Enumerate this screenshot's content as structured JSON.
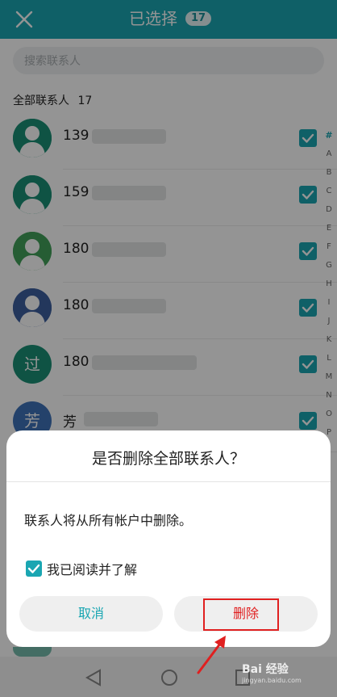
{
  "header": {
    "title": "已选择",
    "count": "17"
  },
  "search": {
    "placeholder": "搜索联系人"
  },
  "section": {
    "label": "全部联系人",
    "count": "17"
  },
  "contacts": [
    {
      "prefix": "139",
      "avatar": "person",
      "color": "#1a8f75",
      "blur": "short"
    },
    {
      "prefix": "159",
      "avatar": "person",
      "color": "#1a8f75",
      "blur": "short"
    },
    {
      "prefix": "180",
      "avatar": "person",
      "color": "#43a05a",
      "blur": "short"
    },
    {
      "prefix": "180",
      "avatar": "person",
      "color": "#3d5f9f",
      "blur": "short"
    },
    {
      "prefix": "180",
      "avatar": "过",
      "color": "#1a8f75",
      "blur": "long"
    },
    {
      "prefix": "芳",
      "avatar": "芳",
      "color": "#3f73b8",
      "blur": "short"
    }
  ],
  "index": [
    "#",
    "A",
    "B",
    "C",
    "D",
    "E",
    "F",
    "G",
    "H",
    "I",
    "J",
    "K",
    "L",
    "M",
    "N",
    "O",
    "P"
  ],
  "dialog": {
    "title": "是否删除全部联系人？",
    "message": "联系人将从所有帐户中删除。",
    "ack_label": "我已阅读并了解",
    "cancel_label": "取消",
    "delete_label": "删除"
  },
  "watermark": {
    "text": "Bai 经验",
    "sub": "jingyan.baidu.com"
  },
  "colors": {
    "accent": "#1aa6b2",
    "danger": "#e02020"
  }
}
